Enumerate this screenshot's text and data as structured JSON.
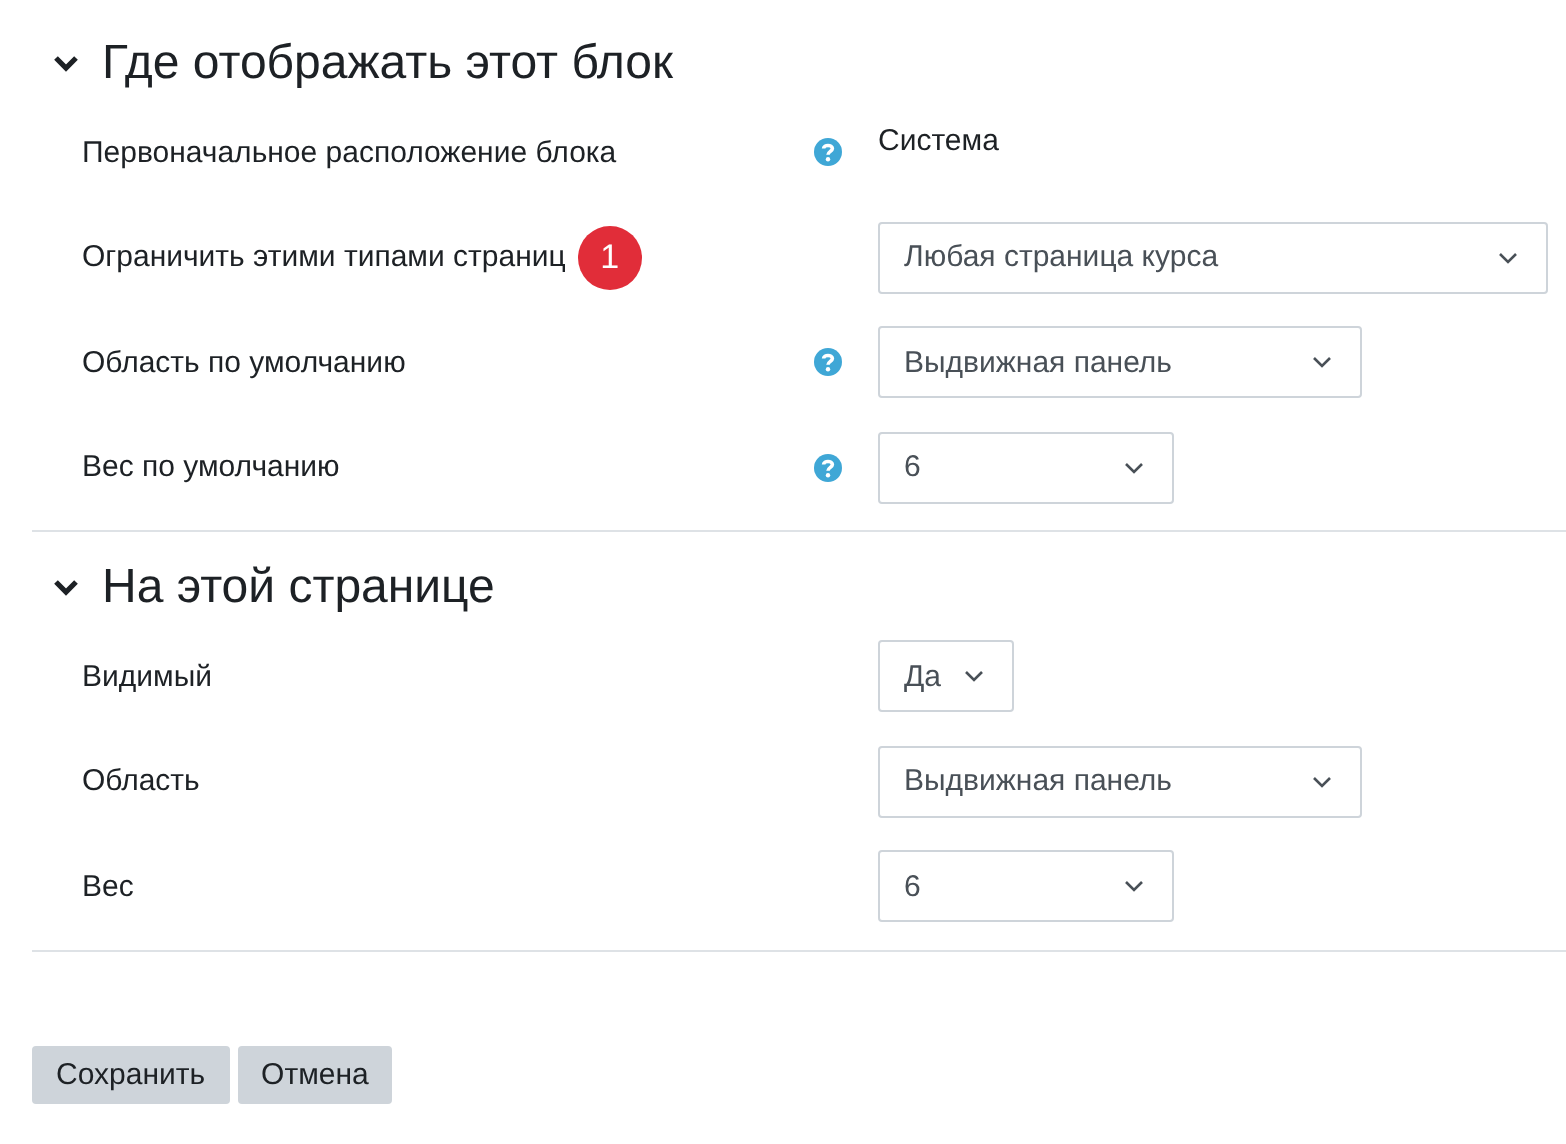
{
  "sections": [
    {
      "title": "Где отображать этот блок",
      "expanded": true,
      "rows": [
        {
          "kind": "static",
          "label": "Первоначальное расположение блока",
          "help": true,
          "value": "Система"
        },
        {
          "kind": "select",
          "label": "Ограничить этими типами страниц",
          "help": false,
          "badge": "1",
          "value": "Любая страница курса"
        },
        {
          "kind": "select",
          "label": "Область по умолчанию",
          "help": true,
          "value": "Выдвижная панель"
        },
        {
          "kind": "select",
          "label": "Вес по умолчанию",
          "help": true,
          "value": "6"
        }
      ]
    },
    {
      "title": "На этой странице",
      "expanded": true,
      "rows": [
        {
          "kind": "select",
          "label": "Видимый",
          "help": false,
          "value": "Да"
        },
        {
          "kind": "select",
          "label": "Область",
          "help": false,
          "value": "Выдвижная панель"
        },
        {
          "kind": "select",
          "label": "Вес",
          "help": false,
          "value": "6"
        }
      ]
    }
  ],
  "buttons": [
    {
      "label": "Сохранить"
    },
    {
      "label": "Отмена"
    }
  ]
}
